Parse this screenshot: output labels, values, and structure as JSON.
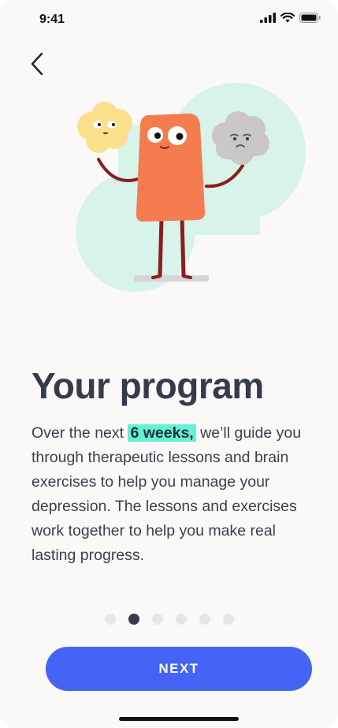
{
  "status_bar": {
    "time": "9:41",
    "icons": [
      "cellular-signal-icon",
      "wifi-icon",
      "battery-icon"
    ]
  },
  "nav": {
    "back_icon": "chevron-left-icon"
  },
  "illustration": {
    "description_icon": "program-characters-illustration",
    "colors": {
      "blob": "#d8f3e9",
      "main_character": "#f57c4f",
      "happy_cloud": "#fbe08c",
      "sad_cloud": "#c9c7c7",
      "legs": "#8b1d1d"
    }
  },
  "content": {
    "title": "Your program",
    "body_prefix": "Over the next",
    "highlight": "6 weeks,",
    "body_rest": "we’ll guide you through therapeutic lessons and brain exercises to help you manage your depression. The lessons and exercises work together to help you make real lasting progress."
  },
  "pager": {
    "count": 6,
    "active_index": 1
  },
  "actions": {
    "next_label": "NEXT"
  },
  "colors": {
    "background": "#faf9f8",
    "title": "#363b4b",
    "accent_button": "#4564f5",
    "highlight": "#64f0d2",
    "dot_inactive": "#e5e6ec",
    "dot_active": "#363b4b"
  }
}
